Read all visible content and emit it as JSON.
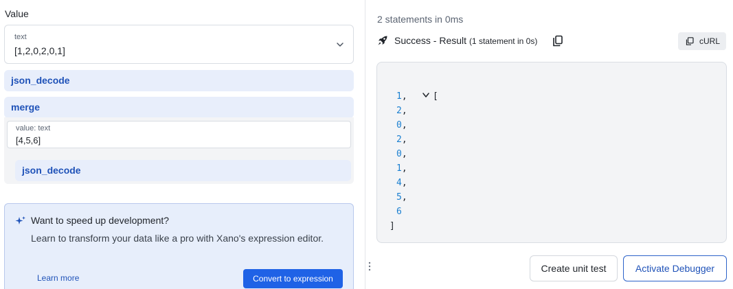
{
  "left": {
    "value_label": "Value",
    "text_field": {
      "label": "text",
      "value": "[1,2,0,2,0,1]"
    },
    "filters": [
      {
        "name": "json_decode"
      },
      {
        "name": "merge",
        "arg": {
          "label": "value: text",
          "value": "[4,5,6]"
        },
        "nested": "json_decode"
      }
    ],
    "promo": {
      "title": "Want to speed up development?",
      "description": "Learn to transform your data like a pro with Xano's expression editor.",
      "learn_more": "Learn more",
      "convert": "Convert to expression"
    }
  },
  "right": {
    "statements": "2 statements in 0ms",
    "status": "Success - Result",
    "status_sub": "(1 statement in 0s)",
    "curl": "cURL",
    "result": {
      "open": "[",
      "close": "]",
      "items": [
        "1,",
        "2,",
        "0,",
        "2,",
        "0,",
        "1,",
        "4,",
        "5,",
        "6"
      ]
    },
    "create_unit_test": "Create unit test",
    "activate_debugger": "Activate Debugger"
  },
  "colors": {
    "accent": "#1f62e6",
    "filter_bg": "#e8eefb",
    "filter_text": "#1f52b8",
    "number": "#1a7fd0"
  },
  "icons": [
    "chevron-down-icon",
    "sparkle-icon",
    "rocket-icon",
    "copy-icon",
    "drag-handle-icon"
  ]
}
